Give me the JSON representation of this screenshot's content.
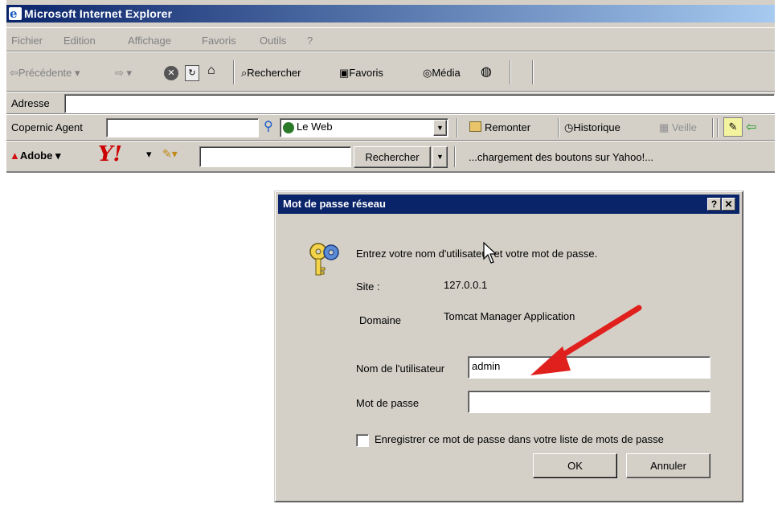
{
  "window": {
    "title": "Microsoft Internet Explorer"
  },
  "menu": [
    "Fichier",
    "Edition",
    "Affichage",
    "Favoris",
    "Outils",
    "?"
  ],
  "toolbar": {
    "back": "Précédente",
    "search": "Rechercher",
    "favorites": "Favoris",
    "media": "Média"
  },
  "address": {
    "label": "Adresse",
    "value": ""
  },
  "copernic": {
    "label": "Copernic Agent",
    "value": "",
    "scope": "Le Web",
    "up": "Remonter",
    "history": "Historique",
    "watch": "Veille"
  },
  "yahoo": {
    "adobe": "Adobe",
    "search_button": "Rechercher",
    "status": "...chargement des boutons sur Yahoo!..."
  },
  "dialog": {
    "title": "Mot de passe réseau",
    "prompt": "Entrez votre nom d'utilisateur et votre mot de passe.",
    "site_label": "Site :",
    "site_value": "127.0.0.1",
    "domain_label": "Domaine",
    "domain_value": "Tomcat Manager Application",
    "user_label": "Nom de l'utilisateur",
    "user_value": "admin",
    "pass_label": "Mot de passe",
    "pass_value": "",
    "remember_label": "Enregistrer ce mot de passe dans votre liste de mots de passe",
    "remember_checked": false,
    "ok": "OK",
    "cancel": "Annuler",
    "help": "?",
    "close": "✕"
  },
  "annotation": {
    "arrow_color": "#e0201c"
  }
}
